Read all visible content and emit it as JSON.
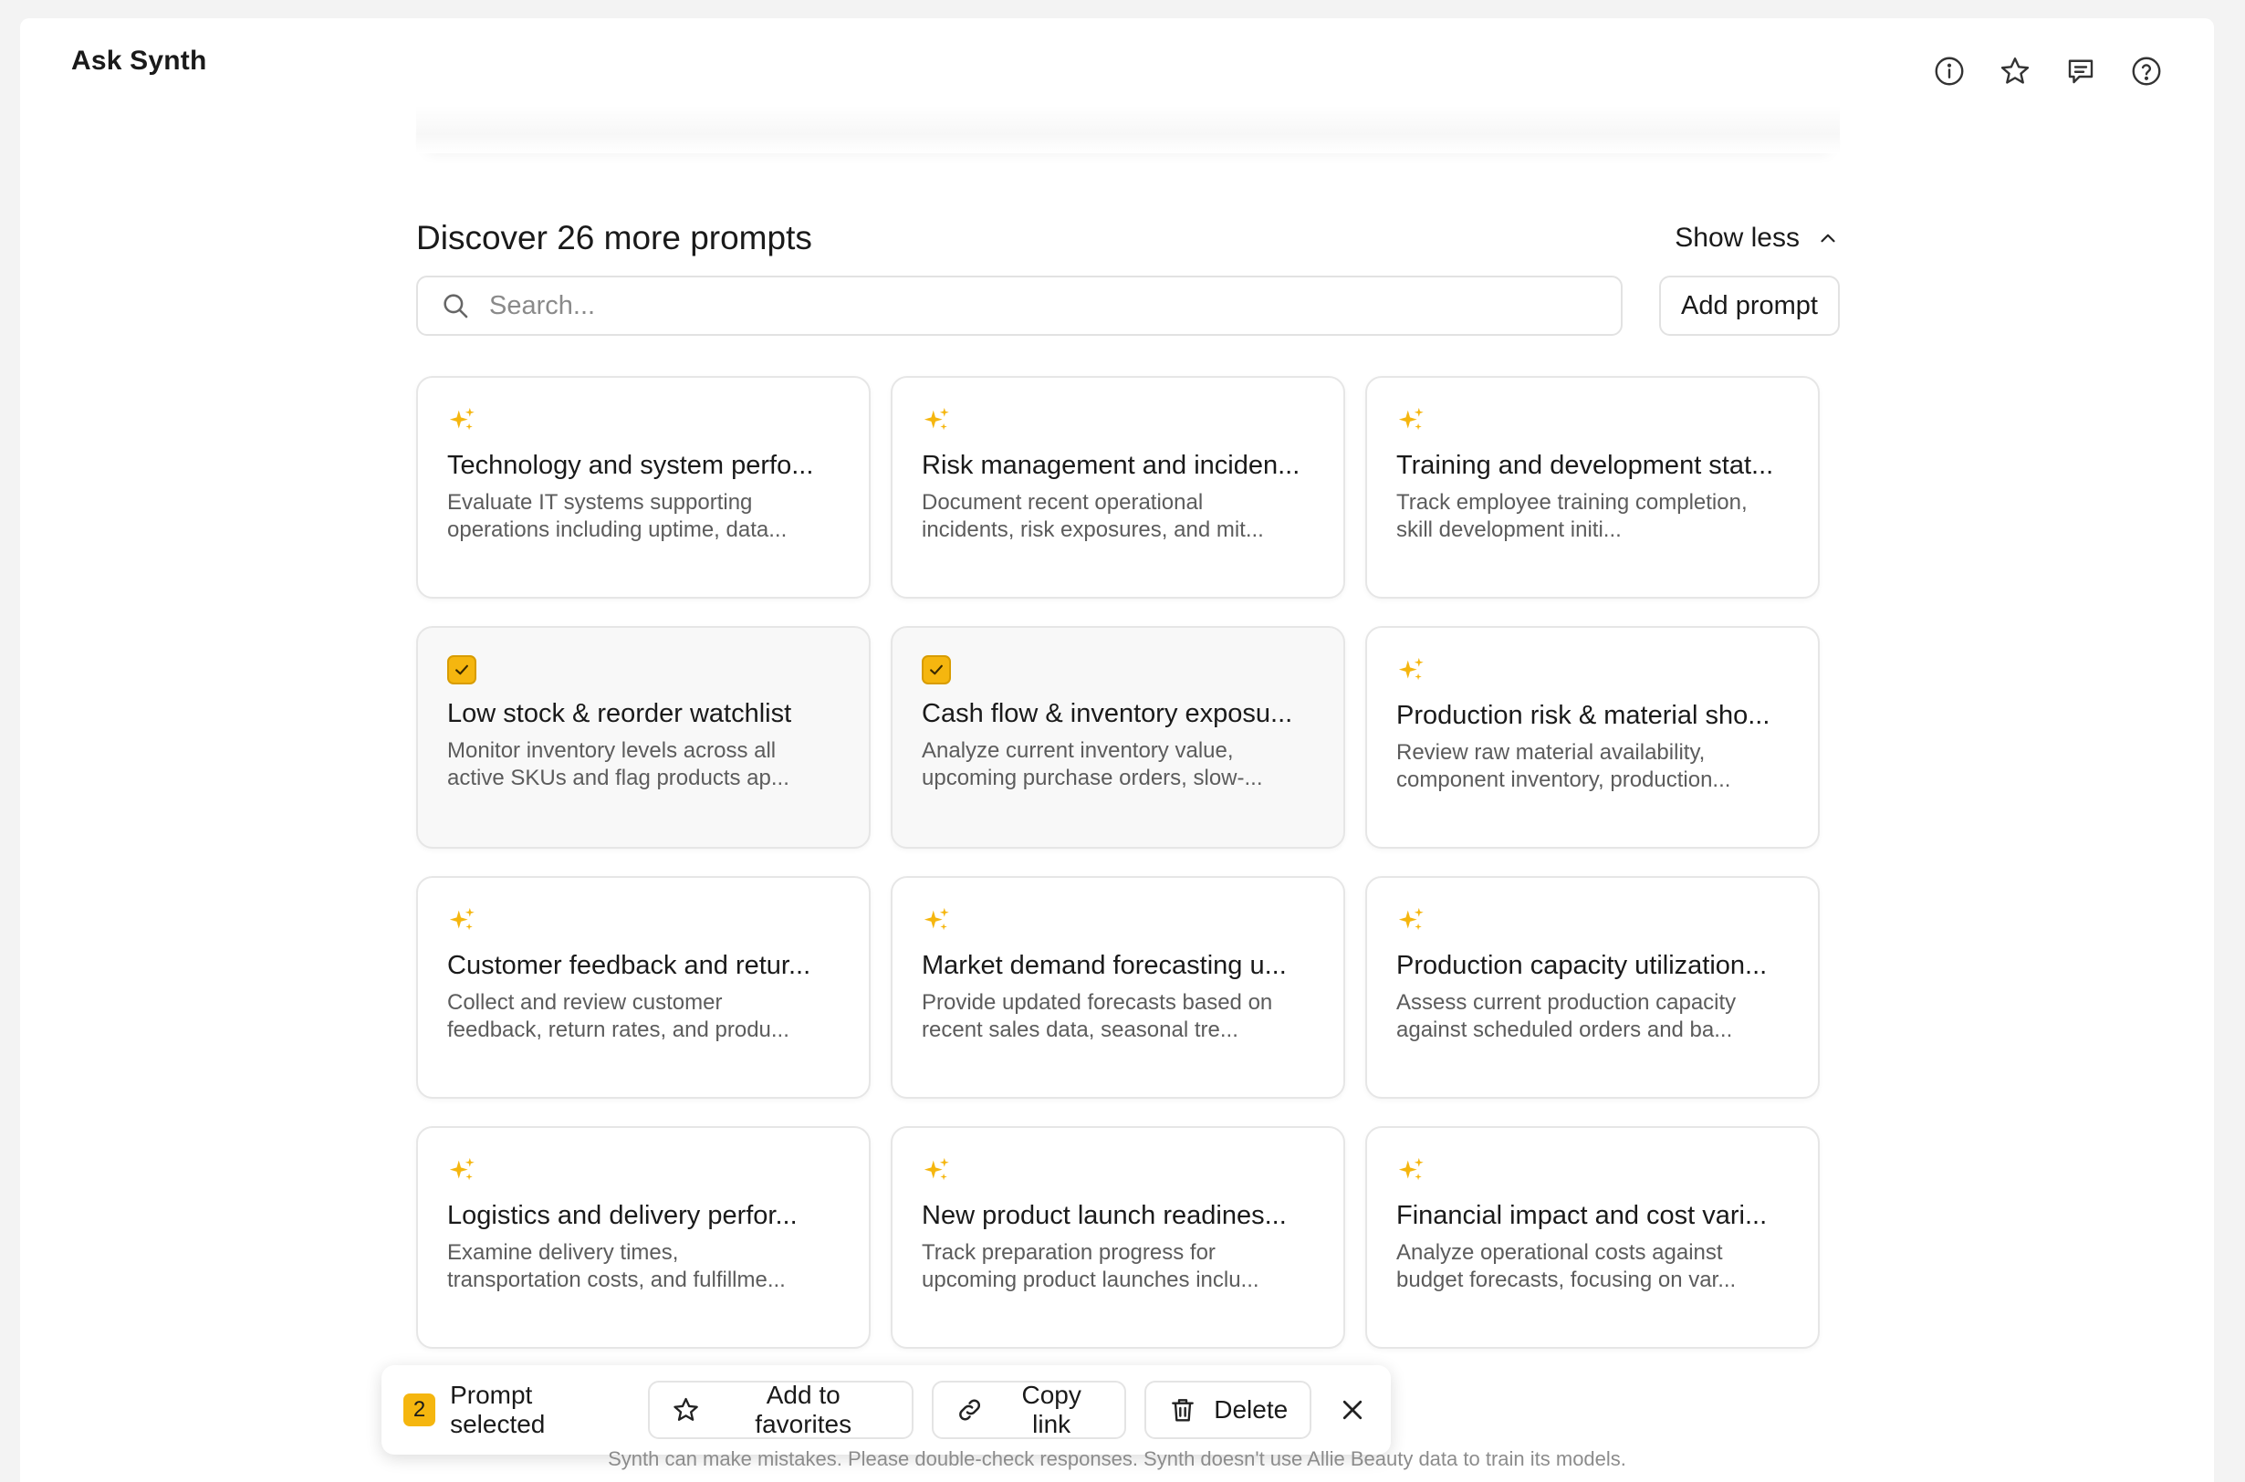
{
  "app": {
    "title": "Ask Synth"
  },
  "top_icons": [
    "info-icon",
    "star-icon",
    "message-icon",
    "help-icon"
  ],
  "section": {
    "title": "Discover 26 more prompts",
    "toggle_label": "Show less"
  },
  "search": {
    "placeholder": "Search...",
    "value": ""
  },
  "add_prompt_label": "Add prompt",
  "colors": {
    "accent": "#f5b60f",
    "selected_bg": "#f8f8f8"
  },
  "cards": [
    {
      "title": "Technology and system perfo...",
      "desc_line1": "Evaluate IT systems supporting",
      "desc_line2": "operations including uptime, data...",
      "selected": false
    },
    {
      "title": "Risk management and inciden...",
      "desc_line1": "Document recent operational",
      "desc_line2": "incidents, risk exposures, and mit...",
      "selected": false
    },
    {
      "title": "Training and development stat...",
      "desc_line1": "Track employee training completion,",
      "desc_line2": "skill development initi...",
      "selected": false
    },
    {
      "title": "Low stock & reorder watchlist",
      "desc_line1": "Monitor inventory levels across all",
      "desc_line2": "active SKUs and flag products ap...",
      "selected": true
    },
    {
      "title": "Cash flow & inventory exposu...",
      "desc_line1": "Analyze current inventory value,",
      "desc_line2": "upcoming purchase orders, slow-...",
      "selected": true
    },
    {
      "title": "Production risk & material sho...",
      "desc_line1": "Review raw material availability,",
      "desc_line2": "component inventory, production...",
      "selected": false
    },
    {
      "title": "Customer feedback and retur...",
      "desc_line1": "Collect and review customer",
      "desc_line2": "feedback, return rates, and produ...",
      "selected": false
    },
    {
      "title": "Market demand forecasting u...",
      "desc_line1": "Provide updated forecasts based on",
      "desc_line2": "recent sales data, seasonal tre...",
      "selected": false
    },
    {
      "title": "Production capacity utilization...",
      "desc_line1": "Assess current production capacity",
      "desc_line2": "against scheduled orders and ba...",
      "selected": false
    },
    {
      "title": "Logistics and delivery perfor...",
      "desc_line1": "Examine delivery times,",
      "desc_line2": "transportation costs, and fulfillme...",
      "selected": false
    },
    {
      "title": "New product launch readines...",
      "desc_line1": "Track preparation progress for",
      "desc_line2": "upcoming product launches inclu...",
      "selected": false
    },
    {
      "title": "Financial impact and cost vari...",
      "desc_line1": "Analyze operational costs against",
      "desc_line2": "budget forecasts, focusing on var...",
      "selected": false
    }
  ],
  "action_bar": {
    "count": "2",
    "count_label": "Prompt selected",
    "favorites_label": "Add to favorites",
    "copy_label": "Copy link",
    "delete_label": "Delete"
  },
  "disclaimer": "Synth can make mistakes. Please double-check responses. Synth doesn't use Allie Beauty data to train its models."
}
